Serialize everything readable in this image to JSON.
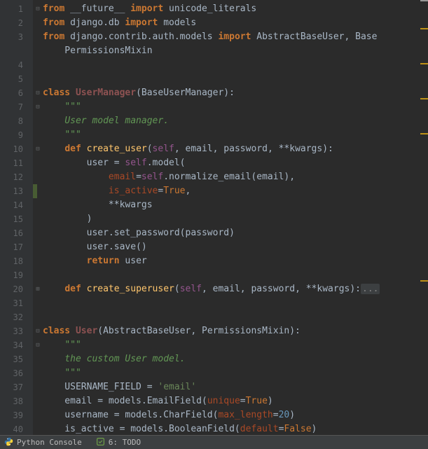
{
  "lines": [
    {
      "n": 1,
      "fold": "⊟",
      "html": "<span class='kw'>from</span> __future__ <span class='kw'>import</span> unicode_literals"
    },
    {
      "n": 2,
      "fold": "",
      "html": "<span class='kw'>from</span> django.db <span class='kw'>import</span> models"
    },
    {
      "n": 3,
      "fold": "",
      "html": "<span class='kw'>from</span> django.contrib.auth.models <span class='kw'>import</span> AbstractBaseUser, Base"
    },
    {
      "n": "",
      "fold": "",
      "html": "    PermissionsMixin"
    },
    {
      "n": 4,
      "fold": "",
      "html": ""
    },
    {
      "n": 5,
      "fold": "",
      "html": ""
    },
    {
      "n": 6,
      "fold": "⊟",
      "html": "<span class='kw'>class</span> <span class='user-cls'>UserManager</span>(BaseUserManager):"
    },
    {
      "n": 7,
      "fold": "⊟",
      "html": "    <span class='doc'>\"\"\"</span>"
    },
    {
      "n": 8,
      "fold": "",
      "html": "    <span class='doc'>User model manager.</span>"
    },
    {
      "n": 9,
      "fold": "",
      "html": "    <span class='doc'>\"\"\"</span>"
    },
    {
      "n": 10,
      "fold": "⊟",
      "html": "    <span class='kw'>def</span> <span class='fn-def'>create_user</span>(<span class='self'>self</span><span class='punct'>,</span> email<span class='punct'>,</span> password<span class='punct'>,</span> **kwargs):"
    },
    {
      "n": 11,
      "fold": "",
      "html": "        user = <span class='self'>self</span>.model("
    },
    {
      "n": 12,
      "fold": "",
      "html": "            <span class='named'>email</span>=<span class='self'>self</span>.normalize_email(email)<span class='punct'>,</span>"
    },
    {
      "n": 13,
      "fold": "",
      "mark": true,
      "html": "            <span class='named'>is_active</span>=<span class='lit'>True</span><span class='punct'>,</span>"
    },
    {
      "n": 14,
      "fold": "",
      "html": "            **kwargs"
    },
    {
      "n": 15,
      "fold": "",
      "html": "        )"
    },
    {
      "n": 16,
      "fold": "",
      "html": "        user.set_password(password)"
    },
    {
      "n": 17,
      "fold": "",
      "html": "        user.save()"
    },
    {
      "n": 18,
      "fold": "",
      "html": "        <span class='kw'>return</span> user"
    },
    {
      "n": 19,
      "fold": "",
      "html": ""
    },
    {
      "n": 20,
      "fold": "⊞",
      "html": "    <span class='kw'>def</span> <span class='fn-def'>create_superuser</span>(<span class='self'>self</span><span class='punct'>,</span> email<span class='punct'>,</span> password<span class='punct'>,</span> **kwargs):<span class='fold-dots'>...</span>"
    },
    {
      "n": 31,
      "fold": "",
      "html": ""
    },
    {
      "n": 32,
      "fold": "",
      "html": ""
    },
    {
      "n": 33,
      "fold": "⊟",
      "html": "<span class='kw'>class</span> <span class='user-cls'>User</span>(AbstractBaseUser<span class='punct'>,</span> PermissionsMixin):"
    },
    {
      "n": 34,
      "fold": "⊟",
      "html": "    <span class='doc'>\"\"\"</span>"
    },
    {
      "n": 35,
      "fold": "",
      "html": "    <span class='doc'>the custom User model.</span>"
    },
    {
      "n": 36,
      "fold": "",
      "html": "    <span class='doc'>\"\"\"</span>"
    },
    {
      "n": 37,
      "fold": "",
      "html": "    USERNAME_FIELD = <span class='str'>'email'</span>"
    },
    {
      "n": 38,
      "fold": "",
      "html": "    email = models.EmailField(<span class='named'>unique</span>=<span class='lit'>True</span>)"
    },
    {
      "n": 39,
      "fold": "",
      "html": "    username = models.CharField(<span class='named'>max_length</span>=<span class='num'>20</span>)"
    },
    {
      "n": 40,
      "fold": "",
      "html": "    is_active = models.BooleanField(<span class='named'>default</span>=<span class='lit'>False</span>)"
    }
  ],
  "statusbar": {
    "python_console": "Python Console",
    "todo": "6: TODO"
  },
  "scroll_warnings": [
    40,
    90,
    140,
    190,
    400
  ]
}
